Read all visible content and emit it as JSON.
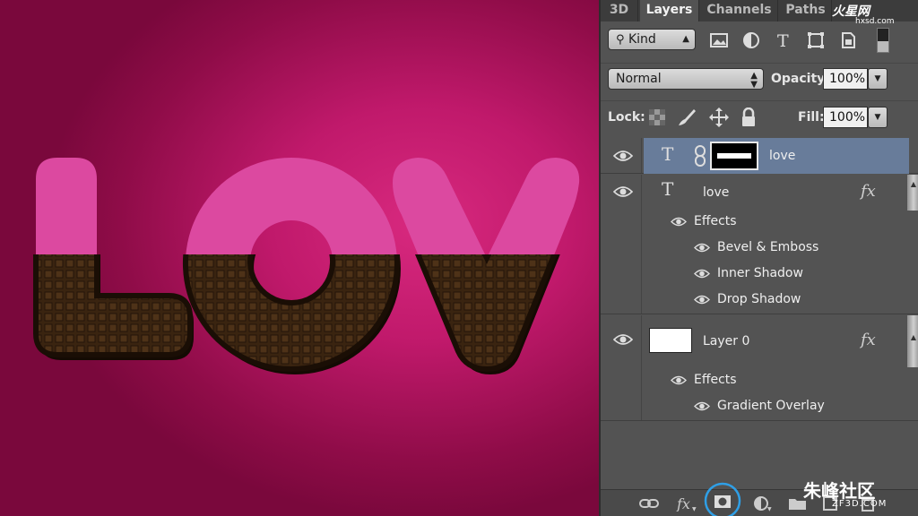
{
  "canvas": {
    "text": "LOV",
    "background_color": "#c0196b",
    "pink_color": "#e04aa0",
    "chocolate_color": "#2e1b0b"
  },
  "panel": {
    "tabs": [
      "3D",
      "Layers",
      "Channels",
      "Paths"
    ],
    "active_tab": "Layers",
    "filter": {
      "label": "Kind"
    },
    "filter_icons": [
      "image-filter-icon",
      "adjustment-filter-icon",
      "type-filter-icon",
      "shape-filter-icon",
      "smart-object-filter-icon",
      "filter-toggle-icon"
    ],
    "blend_mode": "Normal",
    "opacity_label": "Opacity:",
    "opacity_value": "100%",
    "lock_label": "Lock:",
    "lock_icons": [
      "lock-transparent-icon",
      "lock-image-icon",
      "lock-position-icon",
      "lock-all-icon"
    ],
    "fill_label": "Fill:",
    "fill_value": "100%",
    "selected_row_color": "#687c9a",
    "layers": [
      {
        "name": "love",
        "type": "text",
        "has_mask": true,
        "selected": true
      },
      {
        "name": "love",
        "type": "text",
        "fx": "fx",
        "effects_label": "Effects",
        "effects": [
          "Bevel & Emboss",
          "Inner Shadow",
          "Drop Shadow"
        ]
      },
      {
        "name": "Layer 0",
        "type": "pixel",
        "fx": "fx",
        "effects_label": "Effects",
        "effects": [
          "Gradient Overlay"
        ]
      }
    ],
    "bottom_icons": [
      "link-layers-icon",
      "fx-icon",
      "add-mask-icon",
      "adjustment-layer-icon",
      "new-group-icon",
      "new-layer-icon",
      "delete-layer-icon"
    ]
  },
  "watermarks": {
    "top": "火星网",
    "top_sub": "hxsd.com",
    "bottom": "朱峰社区",
    "bottom_sub": "ZF3D.COM"
  }
}
